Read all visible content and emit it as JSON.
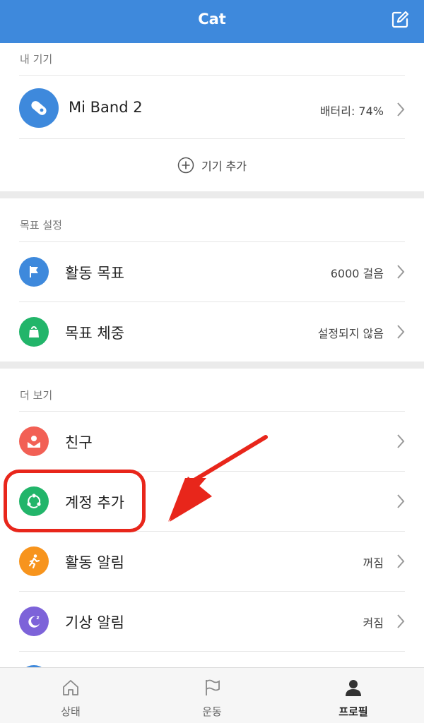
{
  "header": {
    "title": "Cat"
  },
  "my_devices": {
    "section_label": "내 기기",
    "device": {
      "name": "Mi Band 2",
      "battery": "배터리: 74%"
    },
    "add_device_label": "기기 추가"
  },
  "goals": {
    "section_label": "목표 설정",
    "items": [
      {
        "label": "활동 목표",
        "value": "6000 걸음"
      },
      {
        "label": "목표 체중",
        "value": "설정되지 않음"
      }
    ]
  },
  "more": {
    "section_label": "더 보기",
    "items": [
      {
        "label": "친구",
        "value": ""
      },
      {
        "label": "계정 추가",
        "value": ""
      },
      {
        "label": "활동 알림",
        "value": "꺼짐"
      },
      {
        "label": "기상 알림",
        "value": "켜짐"
      }
    ]
  },
  "tabs": [
    {
      "label": "상태"
    },
    {
      "label": "운동"
    },
    {
      "label": "프로필"
    }
  ],
  "colors": {
    "header_bg": "#3e89dc",
    "blue_icon": "#3e89dc",
    "green_icon": "#22b56a",
    "red_icon": "#f26055",
    "orange_icon": "#f7941d",
    "purple_icon": "#7d63d9",
    "highlight": "#e8261b"
  }
}
